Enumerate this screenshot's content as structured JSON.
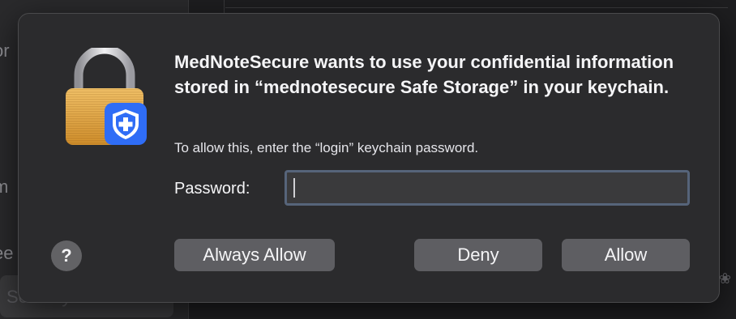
{
  "background": {
    "sidebar_fragments": [
      "or",
      "m",
      "ee"
    ],
    "sidebar_selected": "Security",
    "corner_glyph": "❀"
  },
  "dialog": {
    "title": "MedNoteSecure wants to use your confidential information stored in “mednotesecure Safe Storage” in your keychain.",
    "message": "To allow this, enter the “login” keychain password.",
    "password_label": "Password:",
    "password_value": "",
    "help_label": "?",
    "buttons": {
      "always_allow": "Always Allow",
      "deny": "Deny",
      "allow": "Allow"
    },
    "icon": "lock-with-shield-icon"
  },
  "colors": {
    "dialog_bg": "#2b2b2d",
    "button_bg": "#5e5e62",
    "lock_gold": "#e3a84a",
    "badge_blue": "#2f6df6"
  }
}
